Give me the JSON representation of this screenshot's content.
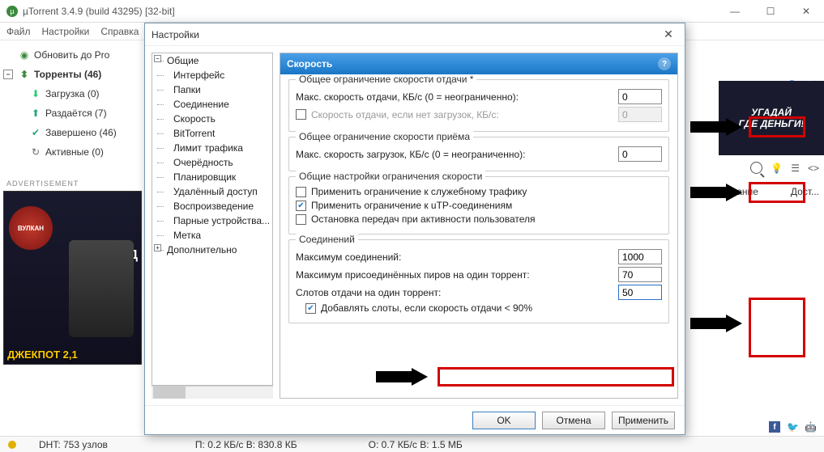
{
  "window": {
    "title": "µTorrent 3.4.9  (build 43295) [32-bit]"
  },
  "menu": {
    "file": "Файл",
    "settings": "Настройки",
    "help": "Справка"
  },
  "nav": {
    "upgrade": "Обновить до Pro",
    "torrents": "Торренты (46)",
    "downloading": "Загрузка (0)",
    "seeding": "Раздаётся (7)",
    "completed": "Завершено (46)",
    "active": "Активные (0)"
  },
  "ad": {
    "label": "ADVERTISEMENT",
    "vulkan": "ВУЛКАН",
    "gd": "ГД",
    "jackpot": "ДЖЕКПОТ 2,1"
  },
  "rightad": {
    "line1": "УГАДАЙ",
    "line2": "ГДЕ ДЕНЬГИ!"
  },
  "report": "Report",
  "tabs": {
    "name": "ание",
    "avail": "Дост..."
  },
  "dialog": {
    "title": "Настройки",
    "tree": [
      "Общие",
      "Интерфейс",
      "Папки",
      "Соединение",
      "Скорость",
      "BitTorrent",
      "Лимит трафика",
      "Очерёдность",
      "Планировщик",
      "Удалённый доступ",
      "Воспроизведение",
      "Парные устройства...",
      "Метка",
      "Дополнительно"
    ],
    "panel_title": "Скорость",
    "grp_up": "Общее ограничение скорости отдачи *",
    "up_label": "Макс. скорость отдачи, КБ/с (0 = неограниченно):",
    "up_val": "0",
    "up_alt_label": "Скорость отдачи, если нет загрузок, КБ/с:",
    "up_alt_val": "0",
    "grp_dn": "Общее ограничение скорости приёма",
    "dn_label": "Макс. скорость загрузок, КБ/с (0 = неограниченно):",
    "dn_val": "0",
    "grp_gen": "Общие настройки ограничения скорости",
    "gen1": "Применить ограничение к служебному трафику",
    "gen2": "Применить ограничение к uTP-соединениям",
    "gen3": "Остановка передач при активности пользователя",
    "grp_conn": "Соединений",
    "conn_max": "Максимум соединений:",
    "conn_max_val": "1000",
    "conn_peers": "Максимум присоединённых пиров на один торрент:",
    "conn_peers_val": "70",
    "conn_slots": "Слотов отдачи на один торрент:",
    "conn_slots_val": "50",
    "conn_add": "Добавлять слоты, если скорость отдачи < 90%",
    "ok": "OK",
    "cancel": "Отмена",
    "apply": "Применить"
  },
  "status": {
    "dht": "DHT: 753 узлов",
    "dn": "П: 0.2 КБ/с B: 830.8 КБ",
    "up": "О: 0.7 КБ/с B: 1.5 МБ"
  }
}
